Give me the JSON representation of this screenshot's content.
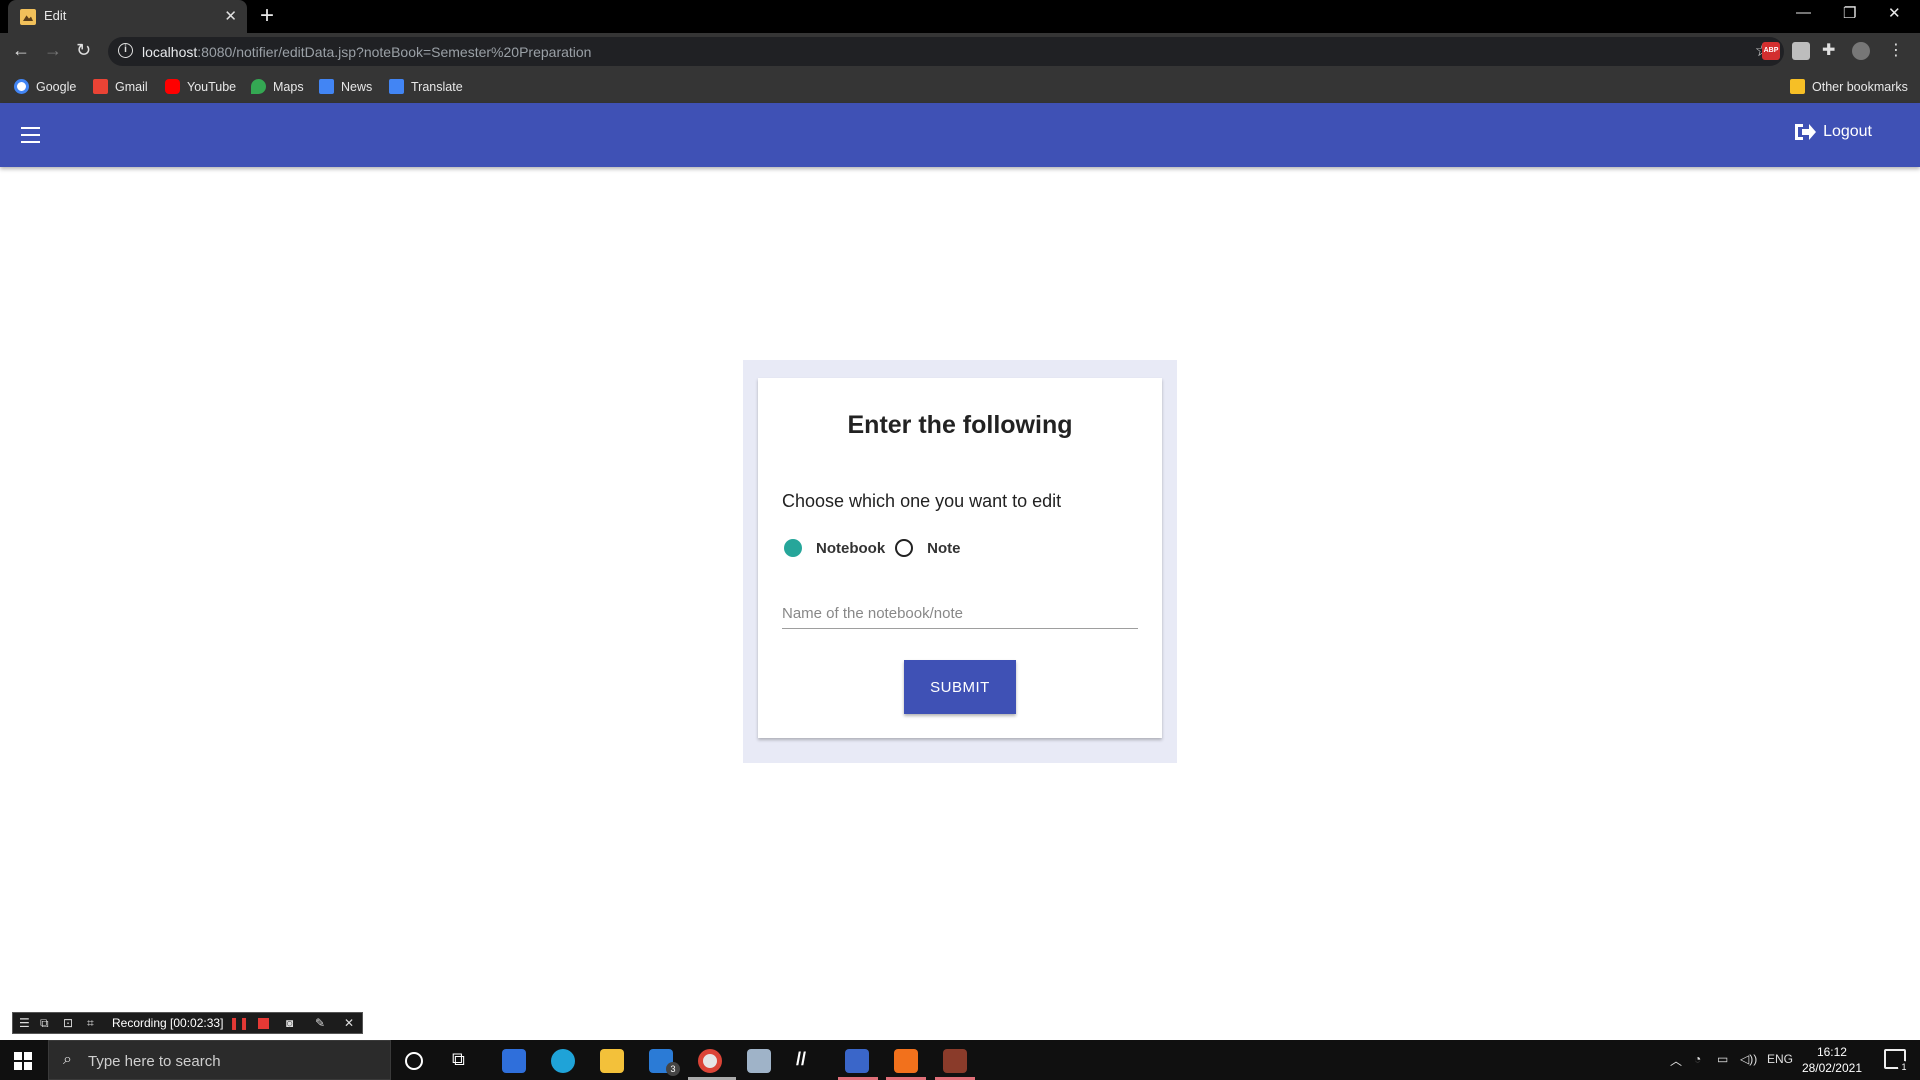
{
  "browser": {
    "tab_title": "Edit",
    "url_host": "localhost",
    "url_rest": ":8080/notifier/editData.jsp?noteBook=Semester%20Preparation",
    "bookmarks": [
      "Google",
      "Gmail",
      "YouTube",
      "Maps",
      "News",
      "Translate"
    ],
    "other_bookmarks": "Other bookmarks"
  },
  "appbar": {
    "logout_label": "Logout",
    "color": "#3f51b5"
  },
  "form": {
    "title": "Enter the following",
    "prompt": "Choose which one you want to edit",
    "options": [
      {
        "label": "Notebook",
        "checked": true
      },
      {
        "label": "Note",
        "checked": false
      }
    ],
    "input_placeholder": "Name of the notebook/note",
    "input_value": "",
    "submit_label": "SUBMIT",
    "accent_color": "#26a69a"
  },
  "recorder": {
    "status": "Recording [00:02:33]"
  },
  "taskbar": {
    "search_placeholder": "Type here to search",
    "mail_badge": "3",
    "language": "ENG",
    "time": "16:12",
    "date": "28/02/2021",
    "notification_count": "1"
  }
}
